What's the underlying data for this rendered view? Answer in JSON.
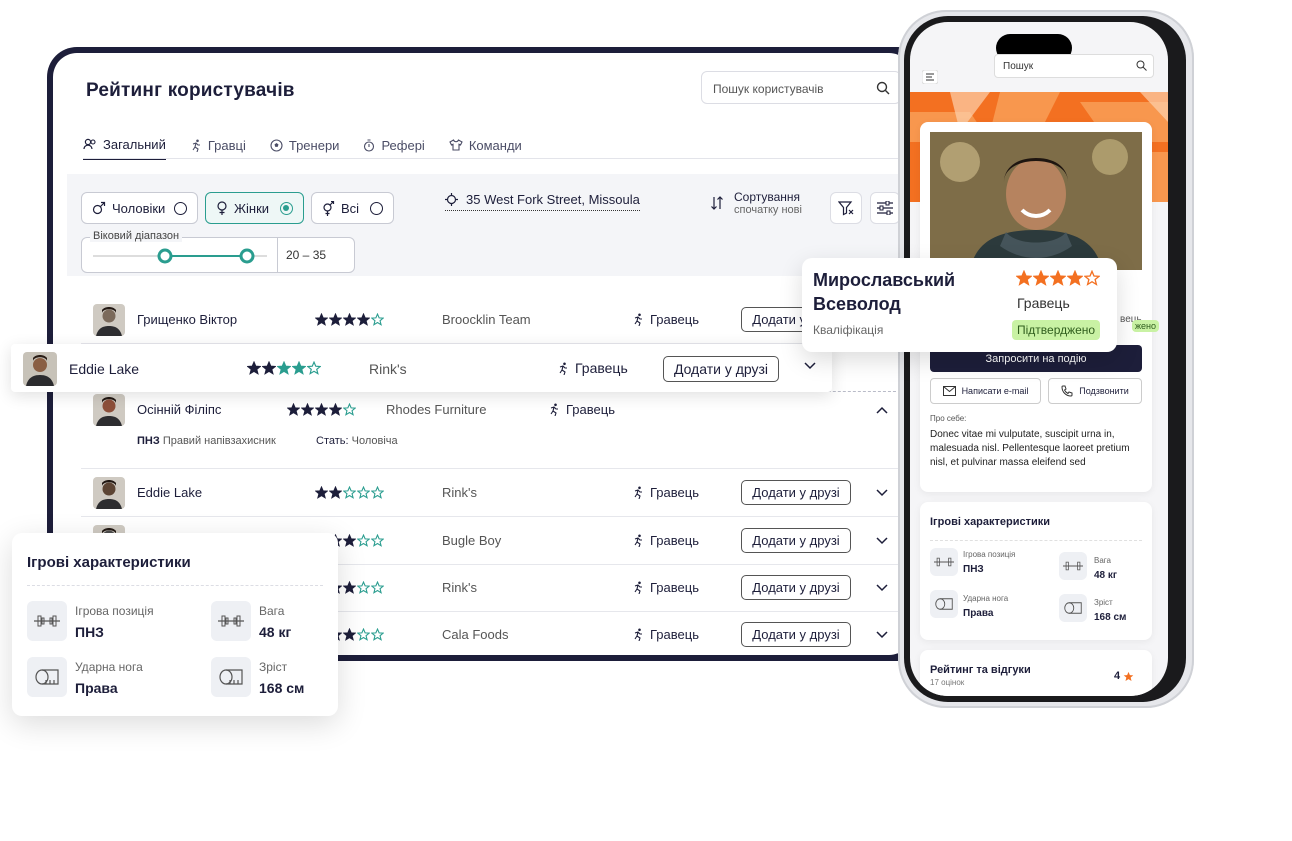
{
  "page": {
    "title": "Рейтинг користувачів",
    "search_placeholder": "Пошук користувачів"
  },
  "tabs": [
    "Загальний",
    "Гравці",
    "Тренери",
    "Рефері",
    "Команди"
  ],
  "filters": {
    "gender": [
      {
        "label": "Чоловіки",
        "selected": false
      },
      {
        "label": "Жінки",
        "selected": true
      },
      {
        "label": "Всі",
        "selected": false
      }
    ],
    "address": "35 West Fork Street, Missoula",
    "sort_title": "Сортування",
    "sort_value": "спочатку нові",
    "age_label": "Віковий діапазон",
    "age_value": "20 – 35"
  },
  "rows": [
    {
      "name": "Грищенко Віктор",
      "rating": 4,
      "team": "Broocklin Team",
      "role": "Гравець",
      "action": "Додати у друзі"
    },
    {
      "name": "Eddie Lake",
      "rating": 4,
      "team": "Rink's",
      "role": "Гравець",
      "action": "Додати у друзі"
    },
    {
      "name": "Осінній Філіпс",
      "rating": 4,
      "team": "Rhodes Furniture",
      "role": "Гравець",
      "position_label": "ПНЗ",
      "position_value": "Правий напівзахисник",
      "sex_label": "Стать:",
      "sex_value": "Чоловіча"
    },
    {
      "name": "Eddie Lake",
      "rating": 2,
      "team": "Rink's",
      "role": "Гравець",
      "action": "Додати у друзі"
    },
    {
      "name": "",
      "rating": 3,
      "team": "Bugle Boy",
      "role": "Гравець",
      "action": "Додати у друзі"
    },
    {
      "name": "",
      "rating": 3,
      "team": "Rink's",
      "role": "Гравець",
      "action": "Додати у друзі"
    },
    {
      "name": "",
      "rating": 3,
      "team": "Cala Foods",
      "role": "Гравець",
      "action": "Додати у друзі"
    }
  ],
  "stats_card": {
    "title": "Ігрові характеристики",
    "items": [
      {
        "label": "Ігрова позиція",
        "value": "ПНЗ"
      },
      {
        "label": "Вага",
        "value": "48 кг"
      },
      {
        "label": "Ударна нога",
        "value": "Права"
      },
      {
        "label": "Зріст",
        "value": "168 см"
      }
    ]
  },
  "profile": {
    "name_line1": "Мирославський",
    "name_line2": "Всеволод",
    "role": "Гравець",
    "qualification": "Кваліфікація",
    "status": "Підтверджено",
    "rating": 4
  },
  "phone": {
    "search_placeholder": "Пошук",
    "invite": "Запросити на подію",
    "email": "Написати e-mail",
    "call": "Подзвонити",
    "about_label": "Про себе:",
    "about_text": "Donec vitae mi vulputate, suscipit urna in, malesuada nisl. Pellentesque laoreet pretium nisl, et pulvinar massa eleifend sed",
    "reviews_title": "Рейтинг та відгуки",
    "reviews_count": "17 оцінок",
    "reviews_rating": "4",
    "hidden_role": "вець",
    "hidden_status": "жено"
  },
  "colors": {
    "navy": "#1d1e3a",
    "teal": "#2a9d8f",
    "orange": "#f37021",
    "green_badge": "#c9f2a4"
  }
}
